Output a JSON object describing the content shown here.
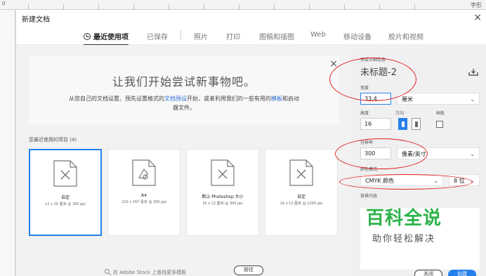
{
  "background": {
    "ruler_zero": "0",
    "right_label": "字形"
  },
  "dialog": {
    "title": "新建文档",
    "close_glyph": "×"
  },
  "tabs": [
    {
      "label": "最近使用项",
      "active": true
    },
    {
      "label": "已保存"
    },
    {
      "label": "照片"
    },
    {
      "label": "打印"
    },
    {
      "label": "图稿和插图"
    },
    {
      "label": "Web"
    },
    {
      "label": "移动设备"
    },
    {
      "label": "胶片和视频"
    }
  ],
  "hero": {
    "title": "让我们开始尝试新事物吧。",
    "text_before": "从您自己的文档设置、预先设置格式的",
    "link1": "文档预设",
    "text_middle": "开始，或者利用我们的一些有用的",
    "link2": "模板",
    "text_after": "和启动器文件。",
    "close_glyph": "×"
  },
  "recent": {
    "label": "您最近使用的项目 (4)",
    "items": [
      {
        "name": "自定",
        "desc": "12 x 16 厘米 @ 300 ppi",
        "selected": true,
        "icon": "blank-document-icon"
      },
      {
        "name": "A4",
        "desc": "210 x 297 毫米 @ 300 ppi",
        "icon": "print-document-icon"
      },
      {
        "name": "默认 Photoshop 大小",
        "desc": "16 x 12 厘米 @ 300 ppi",
        "icon": "blank-document-icon"
      },
      {
        "name": "自定",
        "desc": "16 x 12 厘米 @ 1200 ppi",
        "icon": "blank-document-icon"
      }
    ]
  },
  "search": {
    "placeholder": "在 Adobe Stock 上查找更多模板",
    "button": "前往"
  },
  "panel": {
    "preset_details_label": "预设详细信息",
    "doc_name": "未标题-2",
    "width_label": "宽度",
    "width_value": "33.4",
    "width_unit": "厘米",
    "height_label": "高度",
    "height_value": "16",
    "orientation_label": "方向",
    "artboard_label": "画板",
    "resolution_label": "分辨率",
    "resolution_value": "300",
    "resolution_unit": "像素/英寸",
    "color_mode_label": "颜色模式",
    "color_mode_value": "CMYK 颜色",
    "bit_depth": "8 位",
    "background_label": "背景内容"
  },
  "watermark": {
    "big": "百科全说",
    "small": "助你轻松解决"
  },
  "buttons": {
    "close": "关闭",
    "create": "创建"
  },
  "colors": {
    "accent": "#2680eb",
    "annotation": "#e02020",
    "watermark": "#2db34a"
  }
}
